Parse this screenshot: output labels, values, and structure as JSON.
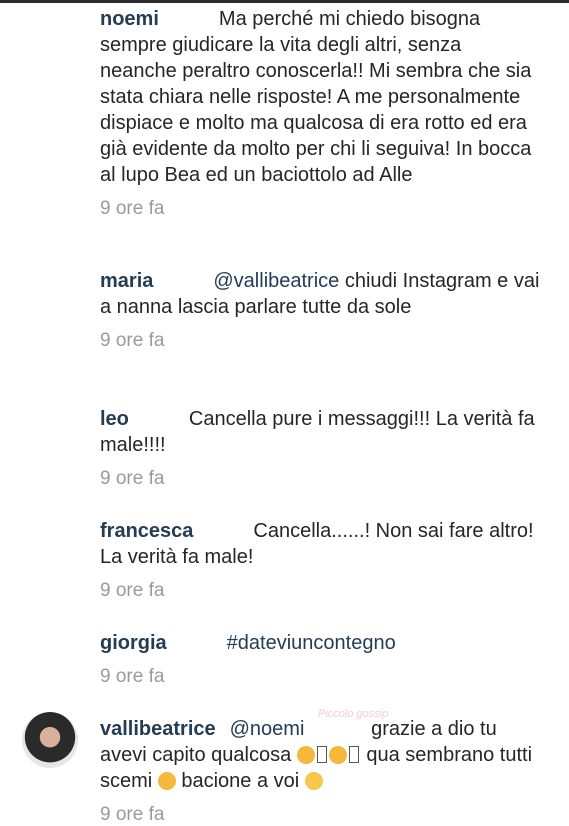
{
  "comments": [
    {
      "user": "noemi",
      "mention": "",
      "text": "Ma perché mi chiedo bisogna sempre giudicare la vita degli altri, senza neanche peraltro conoscerla!! Mi sembra che sia stata chiara nelle risposte! A me personalmente dispiace e molto ma qualcosa di era rotto ed era già evidente da molto per chi li seguiva! In bocca al lupo Bea ed un baciottolo ad Alle",
      "time": "9 ore fa"
    },
    {
      "user": "maria",
      "mention": "@vallibeatrice",
      "text": "chiudi Instagram e vai a nanna lascia parlare tutte da sole",
      "time": "9 ore fa"
    },
    {
      "user": "leo",
      "mention": "",
      "text": "Cancella pure i messaggi!!! La verità fa male!!!!",
      "time": "9 ore fa"
    },
    {
      "user": "francesca",
      "mention": "",
      "text": "Cancella......! Non sai fare altro! La verità fa male!",
      "time": "9 ore fa"
    },
    {
      "user": "giorgia",
      "mention": "#dateviuncontegno",
      "text": "",
      "time": "9 ore fa"
    },
    {
      "user": "vallibeatrice",
      "mention": "@noemi",
      "text_parts": [
        "grazie a dio tu avevi capito qualcosa",
        "qua sembrano tutti scemi",
        "bacione a voi"
      ],
      "time": "9 ore fa"
    }
  ],
  "watermark": "Piccolo gossip",
  "icons": {
    "avatar": "user-avatar-vallibeatrice",
    "emoji_1": "face-with-hands-emoji",
    "emoji_2": "unamused-face-emoji",
    "emoji_3": "kissing-face-emoji"
  }
}
